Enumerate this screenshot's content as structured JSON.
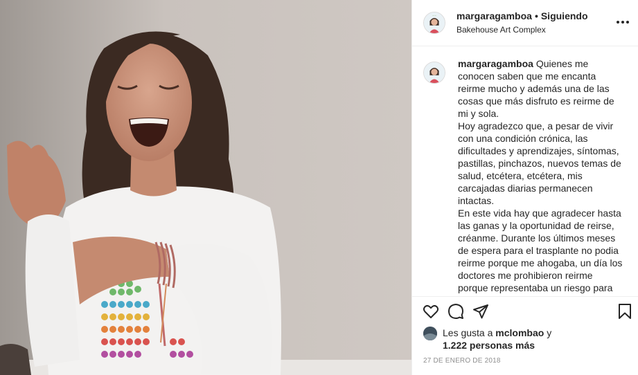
{
  "header": {
    "username": "margaragamboa",
    "separator": "•",
    "follow_status": "Siguiendo",
    "location": "Bakehouse Art Complex"
  },
  "caption": {
    "username": "margaragamboa",
    "paragraphs": [
      "Quienes me conocen saben que me encanta reirme mucho y además una de las cosas que más disfruto es reirme de mi y sola.",
      "Hoy agradezco que, a pesar de vivir con una condición crónica, las dificultades y aprendizajes, síntomas, pastillas, pinchazos, nuevos temas de salud, etcétera, etcétera, mis carcajadas diarias permanecen intactas.",
      "En este vida hay que agradecer hasta las ganas y la oportunidad de reirse, créanme. Durante los últimos meses de espera para el trasplante no podia reirme porque me ahogaba, un día los doctores me prohibieron reirme porque representaba un riesgo para"
    ]
  },
  "actions": {
    "like_icon": "heart-icon",
    "comment_icon": "comment-icon",
    "share_icon": "paper-plane-icon",
    "save_icon": "bookmark-icon"
  },
  "likes": {
    "prefix": "Les gusta a",
    "liker": "mclombao",
    "conjunction": "y",
    "others": "1.222 personas más"
  },
  "date": "27 DE ENERO DE 2018",
  "colors": {
    "text": "#262626",
    "muted": "#8e8e8e",
    "divider": "#efefef"
  }
}
